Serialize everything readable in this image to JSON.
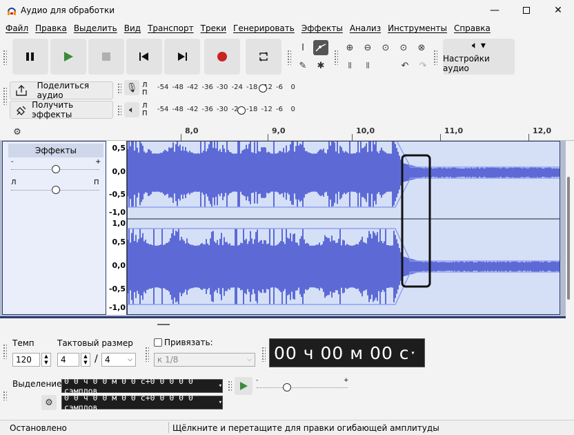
{
  "window": {
    "title": "Аудио для обработки"
  },
  "menu": [
    "Файл",
    "Правка",
    "Выделить",
    "Вид",
    "Транспорт",
    "Треки",
    "Генерировать",
    "Эффекты",
    "Анализ",
    "Инструменты",
    "Справка"
  ],
  "audio_setup": {
    "label": "Настройки аудио"
  },
  "share": {
    "share_label": "Поделиться аудио",
    "effects_label": "Получить эффекты"
  },
  "meters": {
    "rec_channels": [
      "Л",
      "П"
    ],
    "play_channels": [
      "Л",
      "П"
    ],
    "rec_scale": [
      "-54",
      "-48",
      "-42",
      "-36",
      "-30",
      "-24",
      "-18",
      "-12",
      "-6",
      "0"
    ],
    "play_scale": [
      "-54",
      "-48",
      "-42",
      "-36",
      "-30",
      "-24",
      "-18",
      "-12",
      "-6",
      "0"
    ]
  },
  "timeline": {
    "ticks": [
      "8,0",
      "9,0",
      "10,0",
      "11,0",
      "12,0"
    ]
  },
  "track": {
    "effects_label": "Эффекты",
    "gain_minus": "-",
    "gain_plus": "+",
    "pan_left": "Л",
    "pan_right": "П",
    "scale_top": [
      "0,5",
      "0,0",
      "-0,5",
      "-1,0"
    ],
    "scale_bottom": [
      "1,0",
      "0,5",
      "0,0",
      "-0,5",
      "-1,0"
    ]
  },
  "tempo": {
    "label": "Темп",
    "value": "120"
  },
  "time_sig": {
    "label": "Тактовый размер",
    "numerator": "4",
    "slash": "/",
    "denominator": "4"
  },
  "snap": {
    "label": "Привязать:",
    "value": "к 1/8",
    "checked": false
  },
  "time_display": {
    "value": "00 ч 00 м 00 с"
  },
  "selection": {
    "label": "Выделение",
    "start": "0 0 ч 0 0 м 0 0 с+0 0 0 0 0 сэмплов",
    "end": "0 0 ч 0 0 м 0 0 с+0 0 0 0 0 сэмплов",
    "speed_min": "-",
    "speed_max": "+"
  },
  "status": {
    "left": "Остановлено",
    "right": "Щёлкните и перетащите для правки огибающей амплитуды"
  },
  "colors": {
    "wave": "#5d6ad6",
    "wave_bg": "#d5e0f7",
    "record": "#c82424",
    "play": "#3a8a3a"
  }
}
